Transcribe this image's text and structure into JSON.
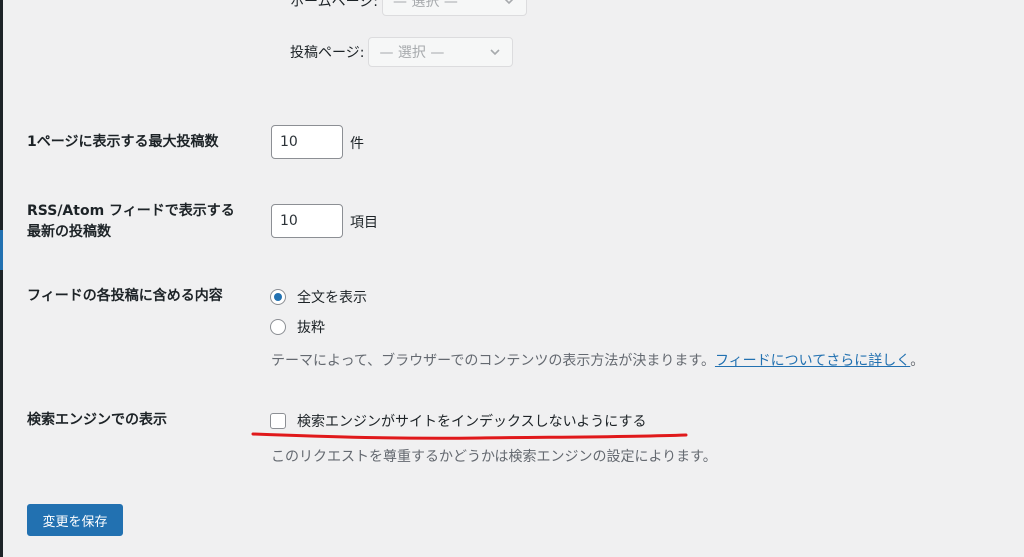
{
  "front_page": {
    "label": "ホームページ:",
    "select_value": "— 選択 —"
  },
  "posts_page": {
    "label": "投稿ページ:",
    "select_value": "— 選択 —"
  },
  "posts_per_page": {
    "label": "1ページに表示する最大投稿数",
    "value": "10",
    "unit": "件"
  },
  "posts_per_rss": {
    "label_line1": "RSS/Atom フィードで表示する",
    "label_line2": "最新の投稿数",
    "value": "10",
    "unit": "項目"
  },
  "feed_content": {
    "label": "フィードの各投稿に含める内容",
    "options": [
      {
        "label": "全文を表示",
        "checked": true
      },
      {
        "label": "抜粋",
        "checked": false
      }
    ],
    "description": "テーマによって、ブラウザーでのコンテンツの表示方法が決まります。",
    "link_text": "フィードについてさらに詳しく",
    "description_end": "。"
  },
  "search_engine": {
    "label": "検索エンジンでの表示",
    "checkbox_label": "検索エンジンがサイトをインデックスしないようにする",
    "checked": false,
    "description": "このリクエストを尊重するかどうかは検索エンジンの設定によります。"
  },
  "save_button": {
    "label": "変更を保存"
  },
  "colors": {
    "accent": "#2271b1",
    "annotation": "#e0191b"
  }
}
